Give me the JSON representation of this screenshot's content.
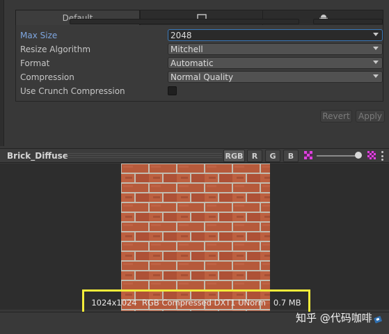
{
  "tabs": [
    {
      "label": "Default",
      "icon": null
    },
    {
      "label": "",
      "icon": "monitor-icon"
    },
    {
      "label": "",
      "icon": "android-icon"
    }
  ],
  "settings": {
    "max_size": {
      "label": "Max Size",
      "value": "2048"
    },
    "resize_algorithm": {
      "label": "Resize Algorithm",
      "value": "Mitchell"
    },
    "format": {
      "label": "Format",
      "value": "Automatic"
    },
    "compression": {
      "label": "Compression",
      "value": "Normal Quality"
    },
    "crunch": {
      "label": "Use Crunch Compression",
      "checked": false
    }
  },
  "buttons": {
    "revert": "Revert",
    "apply": "Apply"
  },
  "preview": {
    "title": "Brick_Diffuse",
    "channels": [
      "RGB",
      "R",
      "G",
      "B"
    ],
    "info": "1024x1024  RGB Compressed DXT1 UNorm   0.7 MB"
  },
  "watermark": "知乎 @代码咖啡",
  "colors": {
    "accent": "#3a79bb",
    "label_highlight": "#7ea6e0",
    "annotation": "#f3ec3a",
    "brick": "#c2603f",
    "mortar": "#cfc8bb"
  },
  "icons": [
    "monitor-icon",
    "android-icon",
    "mip-icon",
    "alpha-icon",
    "kebab-menu-icon",
    "badge-icon"
  ]
}
